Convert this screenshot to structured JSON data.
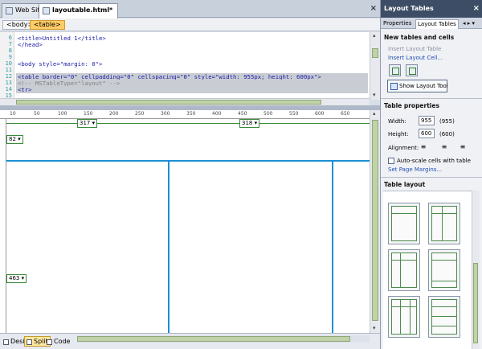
{
  "doc_tabs": [
    {
      "label": "Web Site"
    },
    {
      "label": "layoutable.html*"
    }
  ],
  "tab_close": "×",
  "tag_selector": [
    {
      "label": "<body>"
    },
    {
      "label": "<table>"
    }
  ],
  "code": {
    "line_numbers": [
      "6",
      "7",
      "8",
      "9",
      "10",
      "11",
      "12",
      "13",
      "14",
      "15"
    ],
    "lines": [
      "<title>Untitled 1</title>",
      "</head>",
      "",
      "<body style=\"margin: 0\">",
      "",
      "<table border=\"0\" cellpadding=\"0\" cellspacing=\"0\" style=\"width: 955px; height: 600px\">",
      "    <!-- MSTableType=\"layout\" -->",
      "    <tr>"
    ]
  },
  "ruler": {
    "labels": [
      "10",
      "50",
      "100",
      "150",
      "200",
      "250",
      "300",
      "350",
      "400",
      "450",
      "500",
      "550",
      "600",
      "650"
    ]
  },
  "design": {
    "col1_width": "317 ▾",
    "col2_width": "318 ▾",
    "row1_height": "82 ▾",
    "row2_height": "463 ▾"
  },
  "views": [
    {
      "label": "Design"
    },
    {
      "label": "Split"
    },
    {
      "label": "Code"
    }
  ],
  "panel": {
    "title": "Layout Tables",
    "close": "×",
    "tabs": [
      {
        "label": "Properties"
      },
      {
        "label": "Layout Tables"
      }
    ],
    "tab_nav": "◂ ▸ ▾",
    "new_section": "New tables and cells",
    "insert_table": "Insert Layout Table",
    "insert_cell": "Insert Layout Cell...",
    "show_tool": "Show Layout Tool",
    "props_section": "Table properties",
    "width_label": "Width:",
    "width_value": "955",
    "width_paren": "(955)",
    "height_label": "Height:",
    "height_value": "600",
    "height_paren": "(600)",
    "alignment_label": "Alignment:",
    "autoscale_label": "Auto-scale cells with table",
    "set_margins": "Set Page Margins...",
    "layout_section": "Table layout"
  }
}
